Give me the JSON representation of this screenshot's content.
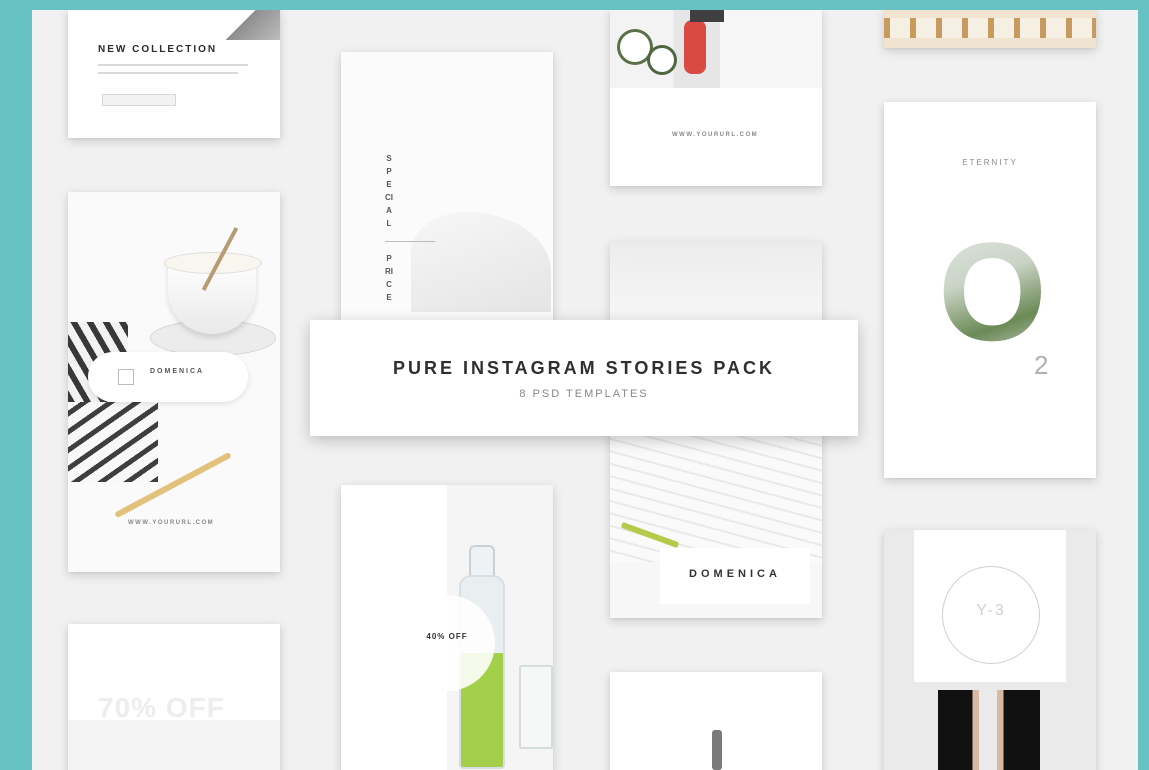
{
  "banner": {
    "headline": "PURE INSTAGRAM STORIES PACK",
    "subheadline": "8 PSD TEMPLATES"
  },
  "cards": {
    "new_collection": {
      "title": "NEW COLLECTION"
    },
    "domenica_coffee": {
      "brand": "DOMENICA",
      "url": "WWW.YOURURL.COM"
    },
    "special_price": {
      "vertical_text_top": "SPECIAL",
      "vertical_text_bottom": "PRICE"
    },
    "sale_bottle": {
      "discount": "40% OFF"
    },
    "sale_text": {
      "discount": "70% OFF"
    },
    "strawberry": {
      "url": "WWW.YOURURL.COM"
    },
    "domenica_desk": {
      "brand": "DOMENICA"
    },
    "eternity": {
      "title": "ETERNITY",
      "big_letter": "O",
      "number": "2"
    },
    "y3": {
      "mark": "Y-3"
    }
  },
  "colors": {
    "background": "#66c2c4",
    "canvas": "#f1f1f1",
    "card": "#ffffff",
    "text_dark": "#2f2f2f",
    "accent_green": "#a4cf4a"
  }
}
